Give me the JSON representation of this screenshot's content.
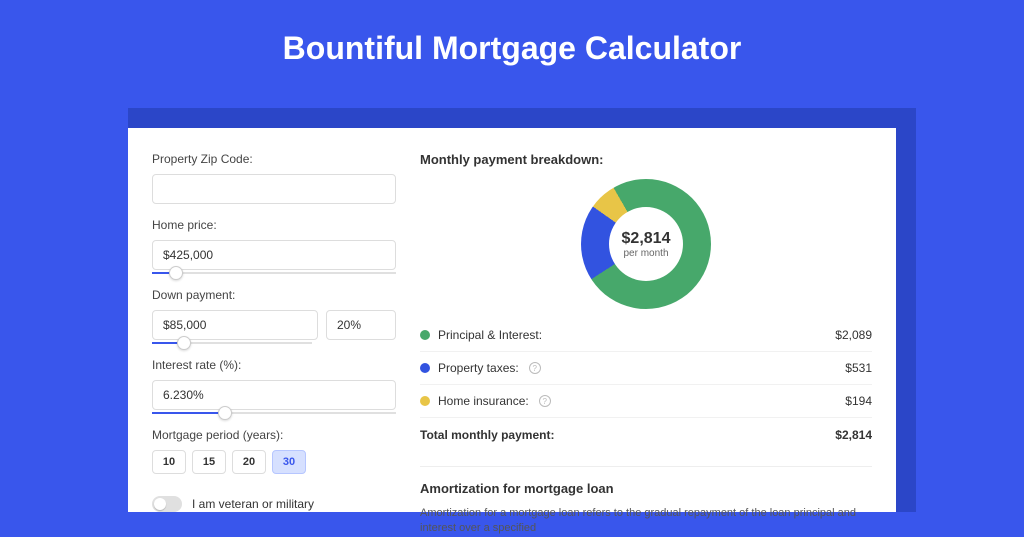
{
  "title": "Bountiful Mortgage Calculator",
  "form": {
    "zip_label": "Property Zip Code:",
    "zip_value": "",
    "home_price_label": "Home price:",
    "home_price_value": "$425,000",
    "home_price_slider_pct": 10,
    "down_payment_label": "Down payment:",
    "down_payment_amount": "$85,000",
    "down_payment_percent": "20%",
    "down_payment_slider_pct": 20,
    "interest_label": "Interest rate (%):",
    "interest_value": "6.230%",
    "interest_slider_pct": 30,
    "period_label": "Mortgage period (years):",
    "periods": [
      "10",
      "15",
      "20",
      "30"
    ],
    "period_selected": "30",
    "veteran_label": "I am veteran or military"
  },
  "breakdown": {
    "title": "Monthly payment breakdown:",
    "center_amount": "$2,814",
    "center_sub": "per month",
    "items": [
      {
        "label": "Principal & Interest:",
        "value": "$2,089",
        "color": "#47a86b",
        "info": false
      },
      {
        "label": "Property taxes:",
        "value": "$531",
        "color": "#3253e0",
        "info": true
      },
      {
        "label": "Home insurance:",
        "value": "$194",
        "color": "#e8c547",
        "info": true
      }
    ],
    "total_label": "Total monthly payment:",
    "total_value": "$2,814"
  },
  "amort": {
    "title": "Amortization for mortgage loan",
    "text": "Amortization for a mortgage loan refers to the gradual repayment of the loan principal and interest over a specified"
  },
  "colors": {
    "green": "#47a86b",
    "blue": "#3253e0",
    "yellow": "#e8c547"
  },
  "chart_data": {
    "type": "pie",
    "title": "Monthly payment breakdown",
    "categories": [
      "Principal & Interest",
      "Property taxes",
      "Home insurance"
    ],
    "values": [
      2089,
      531,
      194
    ],
    "colors": [
      "#47a86b",
      "#3253e0",
      "#e8c547"
    ],
    "total": 2814,
    "center_label": "$2,814 per month"
  }
}
